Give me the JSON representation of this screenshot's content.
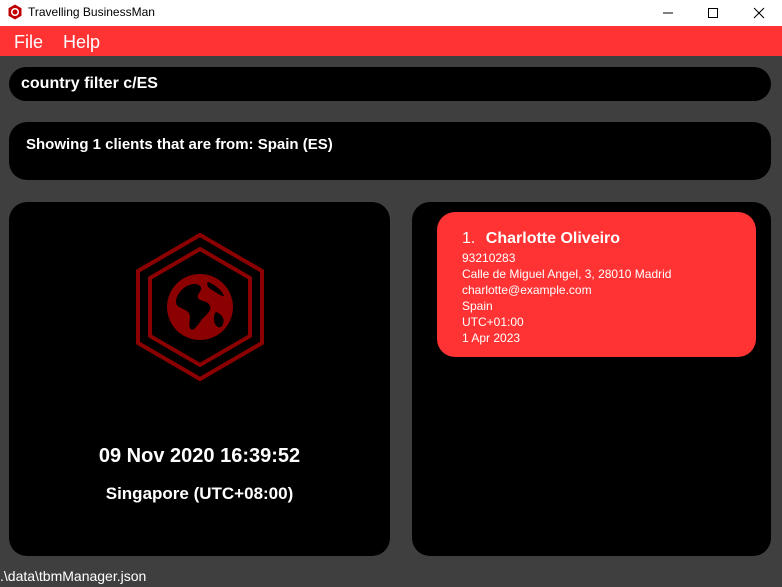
{
  "window": {
    "title": "Travelling BusinessMan",
    "icon": "globe-hexagon-icon"
  },
  "menubar": {
    "file_label": "File",
    "help_label": "Help"
  },
  "command": {
    "value": "country filter c/ES"
  },
  "result": {
    "message": "Showing 1 clients that are from: Spain (ES)"
  },
  "clock": {
    "datetime": "09 Nov 2020 16:39:52",
    "timezone": "Singapore (UTC+08:00)"
  },
  "clients": [
    {
      "index": "1.",
      "name": "Charlotte Oliveiro",
      "phone": "93210283",
      "address": "Calle de Miguel Angel, 3, 28010 Madrid",
      "email": "charlotte@example.com",
      "country": "Spain",
      "timezone": "UTC+01:00",
      "last_modified": "1 Apr 2023"
    }
  ],
  "status": {
    "file_path": ".\\data\\tbmManager.json"
  },
  "colors": {
    "accent": "#ff3333",
    "background": "#3f3f3f",
    "panel": "#000000",
    "logo": "#8b0000"
  }
}
